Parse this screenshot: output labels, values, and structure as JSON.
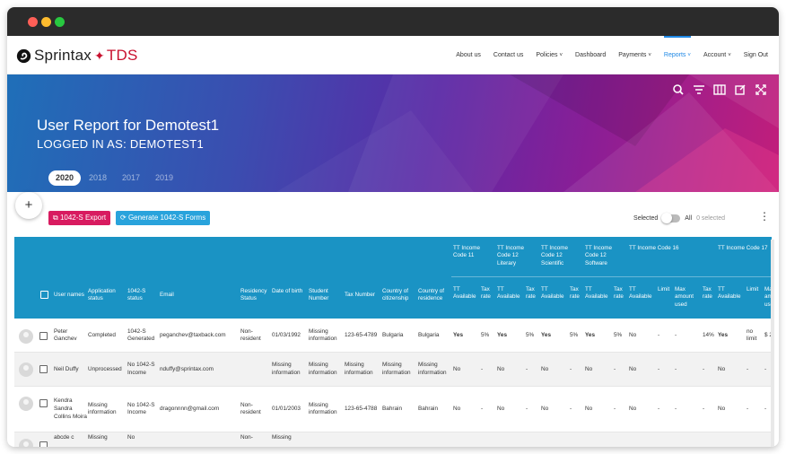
{
  "window": {
    "dots": [
      "#ff5f57",
      "#febc2e",
      "#28c840"
    ]
  },
  "brand": {
    "name": "Sprintax",
    "suffix": "TDS",
    "accent": "#c8102e"
  },
  "nav": {
    "items": [
      {
        "label": "About us"
      },
      {
        "label": "Contact us"
      },
      {
        "label": "Policies",
        "caret": "˅"
      },
      {
        "label": "Dashboard"
      },
      {
        "label": "Payments",
        "caret": "˅"
      },
      {
        "label": "Reports",
        "caret": "˅",
        "active": true
      },
      {
        "label": "Account",
        "caret": "˅"
      },
      {
        "label": "Sign Out"
      }
    ]
  },
  "hero": {
    "title": "User Report for Demotest1",
    "subtitle": "LOGGED IN AS: DEMOTEST1",
    "years": [
      "2020",
      "2018",
      "2017",
      "2019"
    ],
    "active_year": "2020",
    "tools": [
      "search-icon",
      "filter-icon",
      "columns-icon",
      "open-external-icon",
      "fullscreen-icon"
    ]
  },
  "actions": {
    "add": "+",
    "export_label": "1042-S Export",
    "export_color": "#d81b60",
    "generate_label": "Generate 1042-S Forms",
    "generate_color": "#29a3dc",
    "selected_label": "Selected",
    "all_label": "All",
    "count_label": "0 selected",
    "more": "⋮"
  },
  "table": {
    "header_color": "#1a93c4",
    "group_headers": [
      "TT Income Code 11",
      "TT Income Code 12 Literary",
      "TT Income Code 12 Scientific",
      "TT Income Code 12 Software",
      "TT Income Code 16",
      "TT Income Code 17"
    ],
    "columns": [
      "User names",
      "Application status",
      "1042-S status",
      "Email",
      "Residency Status",
      "Date of birth",
      "Student Number",
      "Tax Number",
      "Country of citizenship",
      "Country of residence",
      "TT Available",
      "Tax rate",
      "TT Available",
      "Tax rate",
      "TT Available",
      "Tax rate",
      "TT Available",
      "Tax rate",
      "TT Available",
      "Limit",
      "Max amount used",
      "Tax rate",
      "TT Available",
      "Limit",
      "Max amount used"
    ],
    "rows": [
      [
        "Peter Ganchev",
        "Completed",
        "1042-S Generated",
        "peganchev@taxback.com",
        "Non-resident",
        "01/03/1992",
        "Missing information",
        "123-65-4789",
        "Bulgaria",
        "Bulgaria",
        "Yes",
        "5%",
        "Yes",
        "5%",
        "Yes",
        "5%",
        "Yes",
        "5%",
        "No",
        "-",
        "-",
        "14%",
        "Yes",
        "no limit",
        "$ 2"
      ],
      [
        "Neil Duffy",
        "Unprocessed",
        "No 1042-S Income",
        "nduffy@sprintax.com",
        "",
        "Missing information",
        "Missing information",
        "Missing information",
        "Missing information",
        "Missing information",
        "No",
        "-",
        "No",
        "-",
        "No",
        "-",
        "No",
        "-",
        "No",
        "-",
        "-",
        "-",
        "No",
        "-",
        "-"
      ],
      [
        "Kendra Sandra Collins Moira",
        "Missing information",
        "No 1042-S Income",
        "dragonnnn@gmail.com",
        "Non-resident",
        "01/01/2003",
        "Missing information",
        "123-65-4788",
        "Bahrain",
        "Bahrain",
        "No",
        "-",
        "No",
        "-",
        "No",
        "-",
        "No",
        "-",
        "No",
        "-",
        "-",
        "-",
        "No",
        "-",
        "-"
      ],
      [
        "abcde c",
        "Missing",
        "No",
        "",
        "Non-",
        "Missing",
        "",
        "",
        "",
        "",
        "",
        "",
        "",
        "",
        "",
        "",
        "",
        "",
        "",
        "",
        "",
        "",
        "",
        "",
        ""
      ]
    ]
  }
}
